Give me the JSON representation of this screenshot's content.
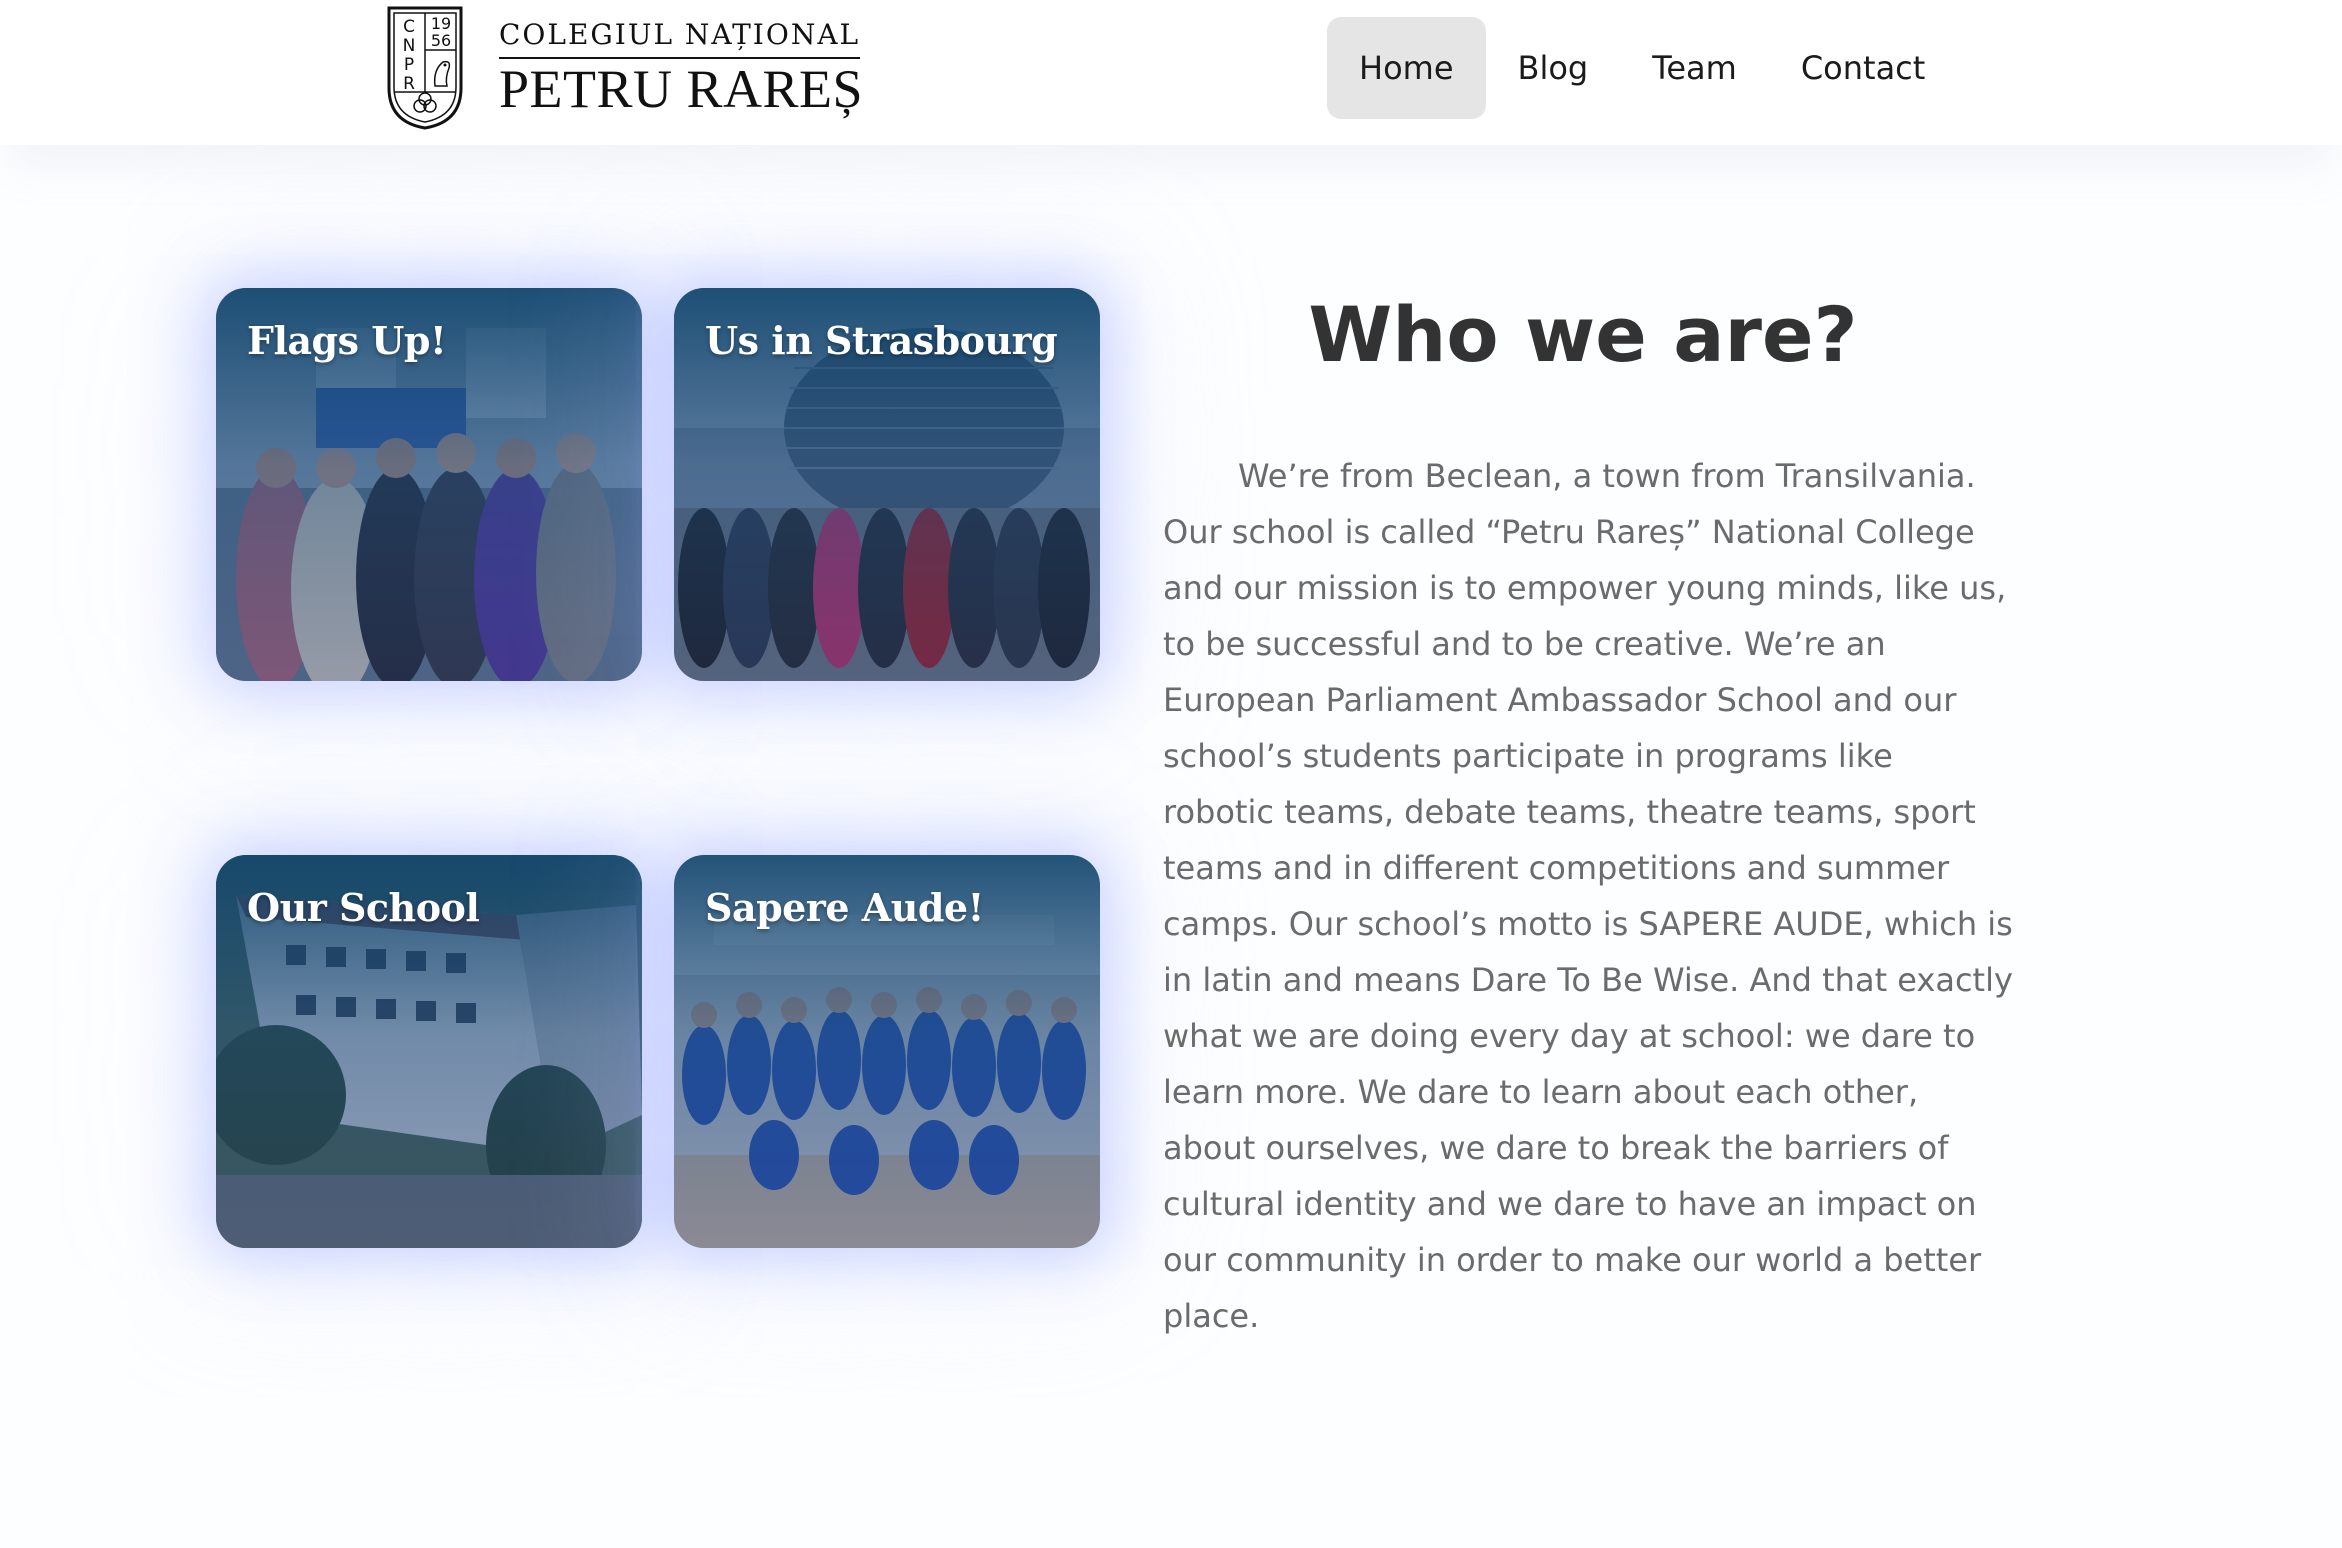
{
  "header": {
    "logo": {
      "crest_letters": [
        "C",
        "N",
        "P",
        "R"
      ],
      "crest_year_top": "19",
      "crest_year_bottom": "56",
      "line1": "COLEGIUL NAȚIONAL",
      "line2": "PETRU RAREȘ"
    },
    "nav": [
      {
        "label": "Home",
        "active": true
      },
      {
        "label": "Blog",
        "active": false
      },
      {
        "label": "Team",
        "active": false
      },
      {
        "label": "Contact",
        "active": false
      }
    ]
  },
  "gallery": {
    "cards": [
      {
        "title": "Flags Up!"
      },
      {
        "title": "Us in Strasbourg"
      },
      {
        "title": "Our School"
      },
      {
        "title": "Sapere Aude!"
      }
    ]
  },
  "about": {
    "title": "Who we are?",
    "text": "We’re from Beclean, a town from Transilvania. Our school is called “Petru Rareș” National College and our mission is to empower young minds, like us, to be successful and to be creative. We’re an European Parliament Ambassador School and our school’s students participate in programs like robotic teams, debate teams, theatre teams, sport teams and in different competitions and summer camps. Our school’s motto is SAPERE AUDE, which is in latin and means Dare To Be Wise. And that exactly what we are doing every day at school: we dare to learn more. We dare to learn about each other, about ourselves, we dare to break the barriers of cultural identity and we dare to have an impact on our community in order to make our world a better place."
  },
  "colors": {
    "nav_active_bg": "#e5e5e5",
    "card_tint": "#12466e",
    "card_glow": "#788cff",
    "title_text": "#333333",
    "body_text": "#6b6b6b"
  }
}
